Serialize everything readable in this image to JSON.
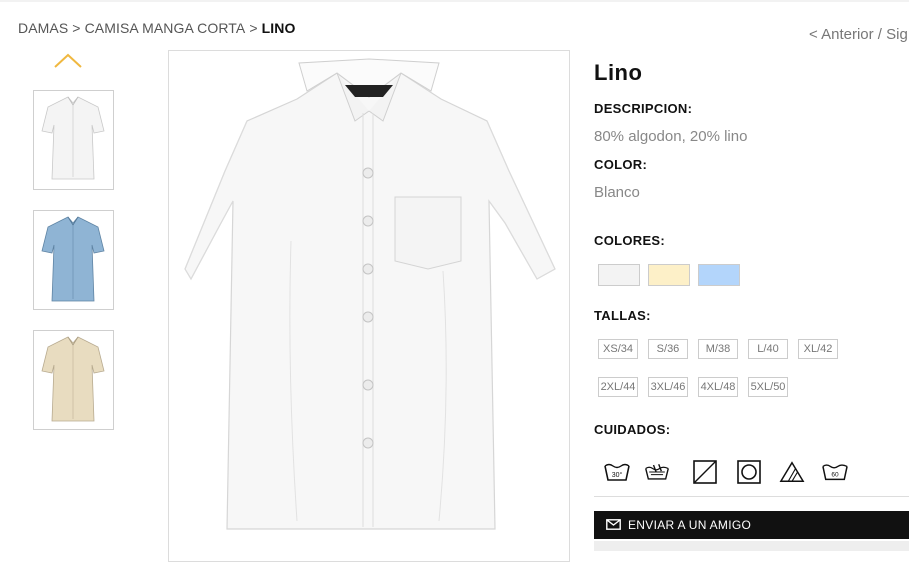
{
  "breadcrumb": {
    "items": [
      "DAMAS",
      "CAMISA MANGA CORTA",
      "LINO"
    ],
    "separator": ">"
  },
  "pager": {
    "text": "< Anterior / Sig"
  },
  "product": {
    "title": "Lino",
    "description_label": "DESCRIPCION:",
    "description": "80% algodon, 20% lino",
    "color_label": "COLOR:",
    "color": "Blanco",
    "colors_label": "COLORES:",
    "swatches": [
      "#f3f3f3",
      "#fdf0c8",
      "#b3d5fb"
    ],
    "sizes_label": "TALLAS:",
    "sizes": [
      "XS/34",
      "S/36",
      "M/38",
      "L/40",
      "XL/42",
      "2XL/44",
      "3XL/46",
      "4XL/48",
      "5XL/50"
    ],
    "care_label": "CUIDADOS:",
    "care_icons": [
      "wash-30-icon",
      "hand-wash-icon",
      "drip-dry-icon",
      "tumble-dry-icon",
      "bleach-icon",
      "wash-60-icon"
    ],
    "care_text": {
      "wash30": "30°",
      "wash60": "60"
    }
  },
  "thumbnails": [
    {
      "name": "white-shirt",
      "color": "#f4f4f4"
    },
    {
      "name": "blue-shirt",
      "color": "#8fb4d4"
    },
    {
      "name": "beige-shirt",
      "color": "#e8dcc0"
    }
  ],
  "send_friend": {
    "label": "ENVIAR A UN AMIGO"
  }
}
